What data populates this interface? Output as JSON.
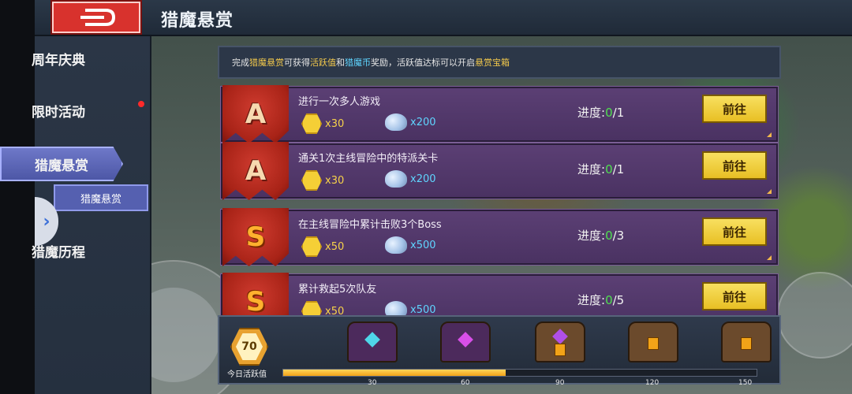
{
  "header": {
    "title": "猎魔悬赏"
  },
  "sidebar": {
    "items": [
      {
        "label": "周年庆典"
      },
      {
        "label": "限时活动"
      },
      {
        "label": "猎魔悬赏"
      },
      {
        "label": "猎魔历程"
      }
    ],
    "sub_item": {
      "label": "猎魔悬赏"
    }
  },
  "banner": {
    "p1": "完成",
    "h1": "猎魔悬赏",
    "p2": "可获得",
    "h2": "活跃值",
    "p3": "和",
    "h3": "猎魔币",
    "p4": "奖励，活跃值达标可以开启",
    "h4": "悬赏宝箱"
  },
  "quests": [
    {
      "rank": "A",
      "title": "进行一次多人游戏",
      "coin": "x30",
      "ore": "x200",
      "progress_label": "进度:",
      "progress_cur": "0",
      "progress_total": "/1",
      "button": "前往"
    },
    {
      "rank": "A",
      "title": "通关1次主线冒险中的特派关卡",
      "coin": "x30",
      "ore": "x200",
      "progress_label": "进度:",
      "progress_cur": "0",
      "progress_total": "/1",
      "button": "前往"
    },
    {
      "rank": "S",
      "title": "在主线冒险中累计击败3个Boss",
      "coin": "x50",
      "ore": "x500",
      "progress_label": "进度:",
      "progress_cur": "0",
      "progress_total": "/3",
      "button": "前往"
    },
    {
      "rank": "S",
      "title": "累计救起5次队友",
      "coin": "x50",
      "ore": "x500",
      "progress_label": "进度:",
      "progress_cur": "0",
      "progress_total": "/5",
      "button": "前往"
    }
  ],
  "activity": {
    "value": "70",
    "label": "今日活跃值",
    "progress_fraction": 0.47,
    "milestones": [
      "30",
      "60",
      "90",
      "120",
      "150"
    ]
  },
  "colors": {
    "accent_gold": "#f2c84b",
    "accent_cyan": "#5fd5ff",
    "progress_green": "#4ee04e",
    "card_purple": "#5b3f74",
    "rank_red": "#cf3b2f"
  }
}
